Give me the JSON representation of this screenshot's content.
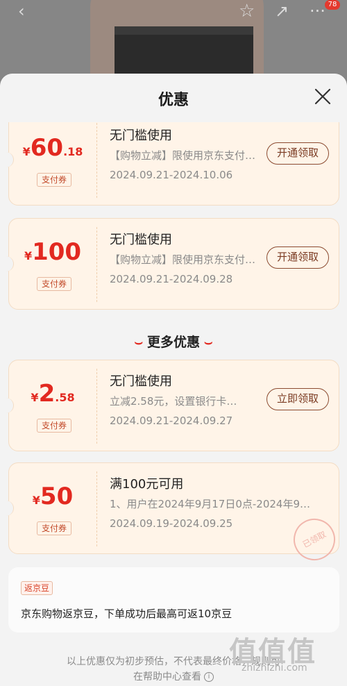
{
  "topbar": {
    "back_icon": "chevron-left-icon",
    "star_icon": "star-icon",
    "share_icon": "share-icon",
    "more_icon": "more-icon",
    "badge_count": "78"
  },
  "sheet": {
    "title": "优惠",
    "close_icon": "close-icon"
  },
  "coupons": [
    {
      "yen": "¥",
      "amount_main": "60",
      "amount_decimal": ".18",
      "tag": "支付券",
      "title": "无门槛使用",
      "desc": "【购物立减】限使用京东支付…",
      "date": "2024.09.21-2024.10.06",
      "button": "开通领取"
    },
    {
      "yen": "¥",
      "amount_main": "100",
      "amount_decimal": "",
      "tag": "支付券",
      "title": "无门槛使用",
      "desc": "【购物立减】限使用京东支付…",
      "date": "2024.09.21-2024.09.28",
      "button": "开通领取"
    }
  ],
  "more_title": "更多优惠",
  "more_coupons": [
    {
      "yen": "¥",
      "amount_main": "2",
      "amount_decimal": ".58",
      "tag": "支付券",
      "title": "无门槛使用",
      "desc": "立减2.58元，设置银行卡…",
      "date": "2024.09.21-2024.09.27",
      "button": "立即领取"
    },
    {
      "yen": "¥",
      "amount_main": "50",
      "amount_decimal": "",
      "tag": "支付券",
      "title": "满100元可用",
      "desc": "1、用户在2024年9月17日0点-2024年9…",
      "date": "2024.09.19-2024.09.25",
      "stamp": "已领取"
    }
  ],
  "jd_bean": {
    "tag": "返京豆",
    "text": "京东购物返京豆，下单成功后最高可返10京豆"
  },
  "footer": {
    "line1": "以上优惠仅为初步预估，不代表最终价格，规则可",
    "line2": "在帮助中心查看"
  },
  "watermark": {
    "big": "值值值",
    "small": "zhizhizhi.com"
  }
}
